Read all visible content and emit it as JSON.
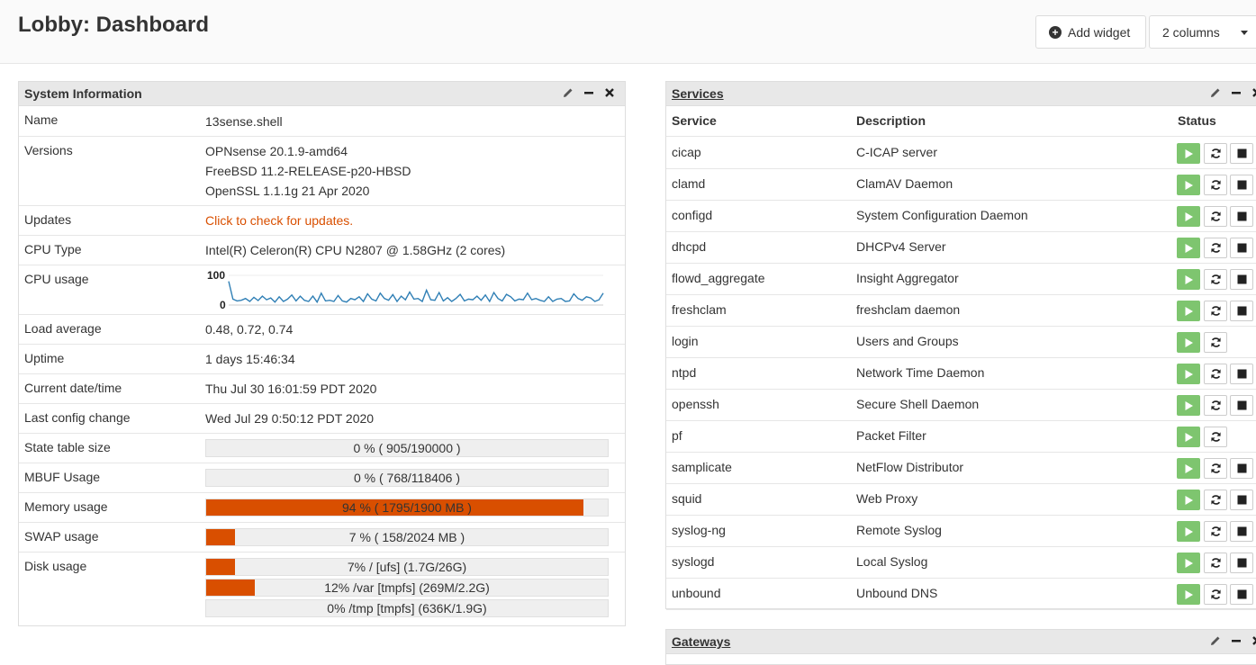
{
  "header": {
    "title": "Lobby: Dashboard",
    "add_widget_label": "Add widget",
    "columns_label": "2 columns"
  },
  "system_info": {
    "title": "System Information",
    "rows": {
      "name": {
        "label": "Name",
        "value": "13sense.shell"
      },
      "versions": {
        "label": "Versions",
        "values": [
          "OPNsense 20.1.9-amd64",
          "FreeBSD 11.2-RELEASE-p20-HBSD",
          "OpenSSL 1.1.1g 21 Apr 2020"
        ]
      },
      "updates": {
        "label": "Updates",
        "value": "Click to check for updates."
      },
      "cpu_type": {
        "label": "CPU Type",
        "value": "Intel(R) Celeron(R) CPU N2807 @ 1.58GHz (2 cores)"
      },
      "cpu_usage": {
        "label": "CPU usage",
        "axis_max": "100",
        "axis_min": "0"
      },
      "load_average": {
        "label": "Load average",
        "value": "0.48, 0.72, 0.74"
      },
      "uptime": {
        "label": "Uptime",
        "value": "1 days 15:46:34"
      },
      "current_datetime": {
        "label": "Current date/time",
        "value": "Thu Jul 30 16:01:59 PDT 2020"
      },
      "last_config": {
        "label": "Last config change",
        "value": "Wed Jul 29 0:50:12 PDT 2020"
      },
      "state_table": {
        "label": "State table size",
        "text": "0 % ( 905/190000 )",
        "fraction": 0.0
      },
      "mbuf": {
        "label": "MBUF Usage",
        "text": "0 % ( 768/118406 )",
        "fraction": 0.0
      },
      "memory": {
        "label": "Memory usage",
        "text": "94 % ( 1795/1900 MB )",
        "fraction": 0.94
      },
      "swap": {
        "label": "SWAP usage",
        "text": "7 % ( 158/2024 MB )",
        "fraction": 0.07
      },
      "disk": {
        "label": "Disk usage",
        "bars": [
          {
            "text": "7% / [ufs] (1.7G/26G)",
            "fraction": 0.07
          },
          {
            "text": "12% /var [tmpfs] (269M/2.2G)",
            "fraction": 0.12
          },
          {
            "text": "0% /tmp [tmpfs] (636K/1.9G)",
            "fraction": 0.0
          }
        ]
      }
    },
    "cpu_series": [
      80,
      20,
      14,
      16,
      22,
      12,
      26,
      15,
      30,
      18,
      24,
      10,
      28,
      12,
      20,
      34,
      14,
      30,
      16,
      12,
      30,
      10,
      40,
      14,
      16,
      12,
      32,
      14,
      10,
      22,
      18,
      28,
      12,
      38,
      20,
      14,
      40,
      22,
      16,
      35,
      12,
      30,
      18,
      44,
      20,
      22,
      12,
      50,
      18,
      16,
      42,
      14,
      25,
      12,
      22,
      36,
      14,
      20,
      18,
      30,
      16,
      34,
      12,
      42,
      22,
      14,
      36,
      28,
      14,
      20,
      18,
      40,
      18,
      22,
      16,
      12,
      28,
      12,
      20,
      22,
      12,
      14,
      38,
      22,
      16,
      28,
      24,
      12,
      18,
      40
    ]
  },
  "services": {
    "title": "Services",
    "columns": {
      "service": "Service",
      "description": "Description",
      "status": "Status"
    },
    "rows": [
      {
        "name": "cicap",
        "desc": "C-ICAP server",
        "stop": true
      },
      {
        "name": "clamd",
        "desc": "ClamAV Daemon",
        "stop": true
      },
      {
        "name": "configd",
        "desc": "System Configuration Daemon",
        "stop": true
      },
      {
        "name": "dhcpd",
        "desc": "DHCPv4 Server",
        "stop": true
      },
      {
        "name": "flowd_aggregate",
        "desc": "Insight Aggregator",
        "stop": true
      },
      {
        "name": "freshclam",
        "desc": "freshclam daemon",
        "stop": true
      },
      {
        "name": "login",
        "desc": "Users and Groups",
        "stop": false
      },
      {
        "name": "ntpd",
        "desc": "Network Time Daemon",
        "stop": true
      },
      {
        "name": "openssh",
        "desc": "Secure Shell Daemon",
        "stop": true
      },
      {
        "name": "pf",
        "desc": "Packet Filter",
        "stop": false
      },
      {
        "name": "samplicate",
        "desc": "NetFlow Distributor",
        "stop": true
      },
      {
        "name": "squid",
        "desc": "Web Proxy",
        "stop": true
      },
      {
        "name": "syslog-ng",
        "desc": "Remote Syslog",
        "stop": true
      },
      {
        "name": "syslogd",
        "desc": "Local Syslog",
        "stop": true
      },
      {
        "name": "unbound",
        "desc": "Unbound DNS",
        "stop": true
      }
    ]
  },
  "gateways": {
    "title": "Gateways"
  },
  "colors": {
    "accent": "#d94f00",
    "running": "#7ec56f",
    "panel_header": "#e8e8e8",
    "chart_line": "#2f7fb5"
  }
}
